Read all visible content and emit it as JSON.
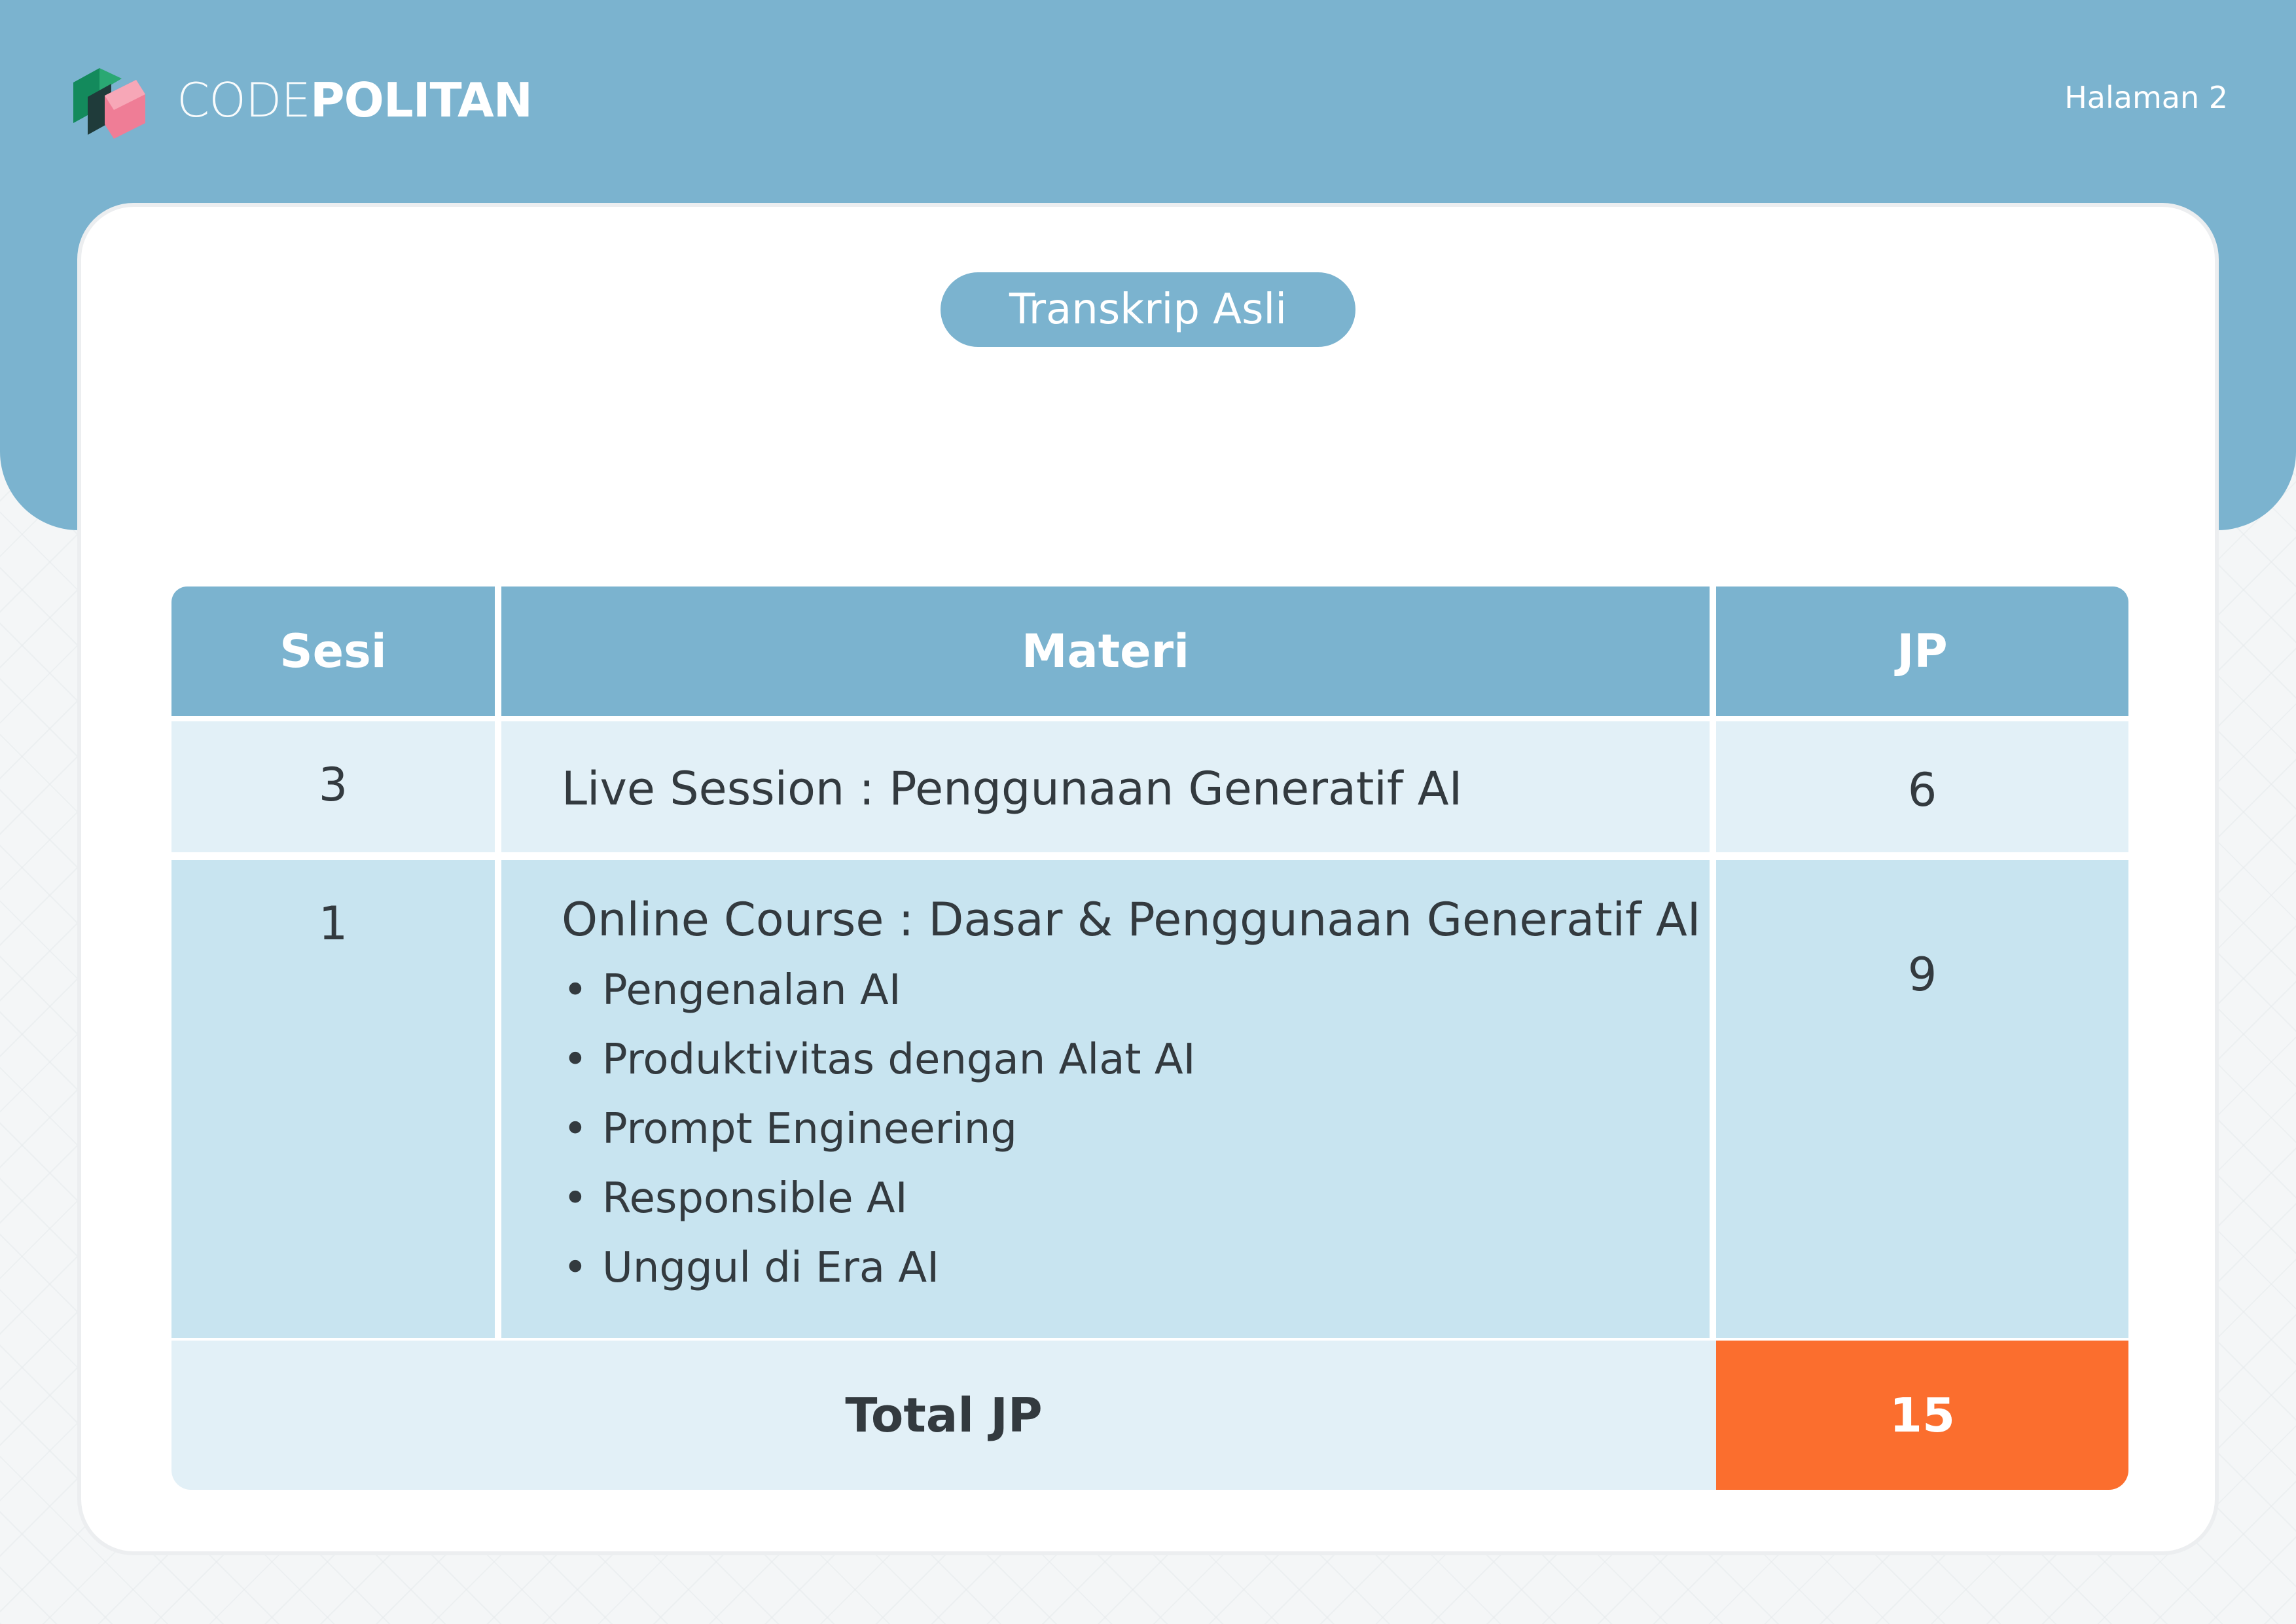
{
  "brand": {
    "name_light": "CODE",
    "name_bold": "POLITAN"
  },
  "page_label": "Halaman 2",
  "section_title": "Transkrip Asli",
  "table": {
    "headers": {
      "session": "Sesi",
      "material": "Materi",
      "jp": "JP"
    },
    "rows": [
      {
        "session": "3",
        "title": "Live Session : Penggunaan Generatif AI",
        "jp": "6",
        "bullets": []
      },
      {
        "session": "1",
        "title": "Online Course : Dasar & Penggunaan Generatif AI",
        "jp": "9",
        "bullets": [
          "Pengenalan AI",
          "Produktivitas dengan Alat AI",
          "Prompt Engineering",
          "Responsible AI",
          "Unggul di Era AI"
        ]
      }
    ],
    "total_label": "Total JP",
    "total_value": "15"
  },
  "colors": {
    "accent_blue": "#7bb3cf",
    "row_light": "#e2f0f7",
    "row_mid": "#c8e4f0",
    "total_orange": "#fb6e2e"
  },
  "icons": {
    "logo": "codepolitan-cube-logo-icon"
  }
}
